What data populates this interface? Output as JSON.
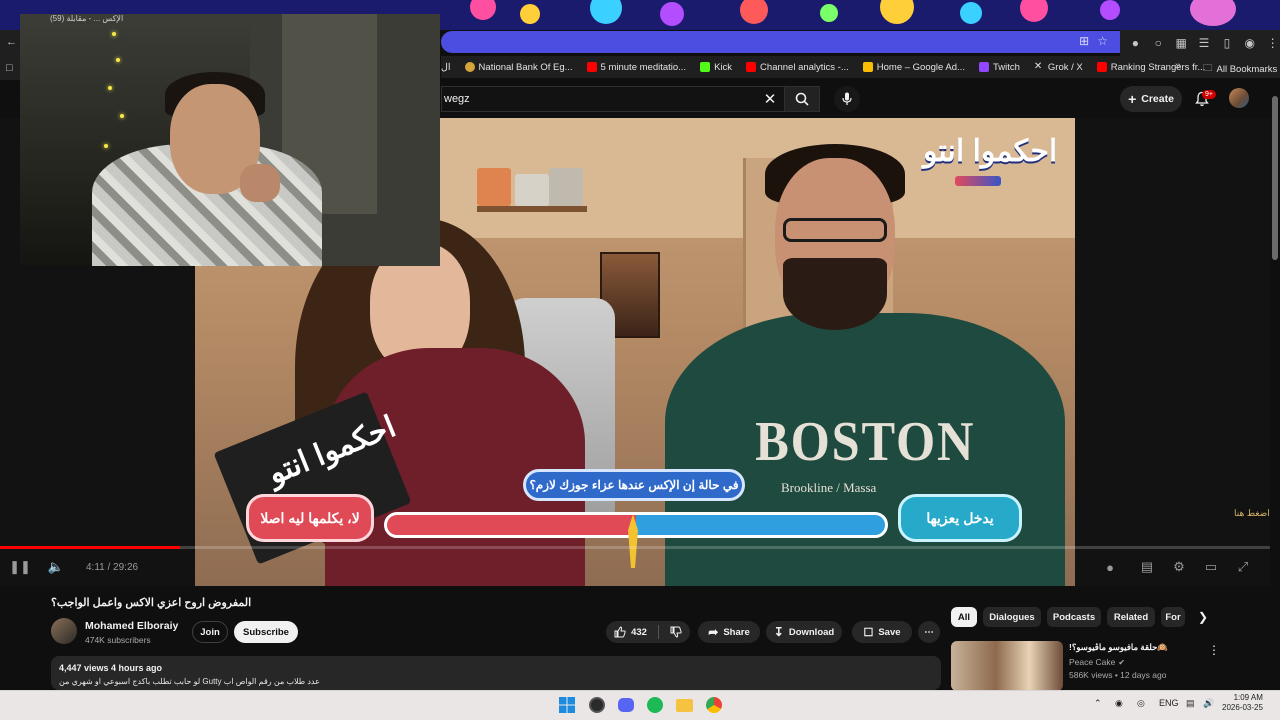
{
  "browser": {
    "webcam_tab_text": "(59) الإكس ... - مقابلة",
    "bookmarks": [
      {
        "label": "ال",
        "icon_color": "#e8b04a"
      },
      {
        "label": "National Bank Of Eg...",
        "icon_color": "#d4a53a"
      },
      {
        "label": "5 minute meditatio...",
        "icon_color": "#ff0000"
      },
      {
        "label": "Kick",
        "icon_color": "#53fc18"
      },
      {
        "label": "Channel analytics -...",
        "icon_color": "#ff0000"
      },
      {
        "label": "Home – Google Ad...",
        "icon_color": "#fbbc04"
      },
      {
        "label": "Twitch",
        "icon_color": "#9146ff"
      },
      {
        "label": "Grok / X",
        "icon_color": "#e3e3e3"
      },
      {
        "label": "Ranking Strangers fr...",
        "icon_color": "#ff0000"
      }
    ],
    "all_bookmarks": "All Bookmarks"
  },
  "youtube": {
    "search_value": "wegz",
    "create_label": "Create",
    "notification_badge": "9+"
  },
  "player": {
    "time": "4:11 / 29:26",
    "played_fraction": 0.142,
    "overlay": {
      "question": "في حالة إن الإكس عندها عزاء جوزك لازم؟",
      "option_left": "لا، يكلمها ليه اصلا",
      "option_right": "يدخل يعزيها",
      "bar_split": 0.5,
      "logo_text": "احكموا انتو",
      "logo_badge": "طبع",
      "shirt_text": "BOSTON",
      "shirt_sub": "Brookline / Massa"
    },
    "side_hint": "اضغط هنا"
  },
  "video": {
    "title": "المفروض اروح اعزي الاكس واعمل الواجب؟",
    "channel_name": "Mohamed Elboraiy",
    "subscribers": "474K subscribers",
    "join_label": "Join",
    "subscribe_label": "Subscribe",
    "likes": "432",
    "share_label": "Share",
    "download_label": "Download",
    "save_label": "Save",
    "views_meta": "4,447 views  4 hours ago",
    "description": "لو حابب تطلب باكدج اسبوعي او شهري من Gutty  عدد طلاب من رقم الواص اب"
  },
  "chips": [
    "All",
    "Dialogues",
    "Podcasts",
    "Related",
    "For"
  ],
  "recommendation": {
    "title": "🙉حلقة مافيوسو ماڤيوسو؟!",
    "channel": "Peace Cake",
    "meta": "586K views • 12 days ago"
  },
  "taskbar": {
    "lang": "ENG",
    "time": "1:09 AM",
    "date": "2026-03-25"
  },
  "colors": {
    "accent_red": "#ff0000",
    "poll_red": "#e04a56",
    "poll_blue": "#2f9fe0"
  }
}
